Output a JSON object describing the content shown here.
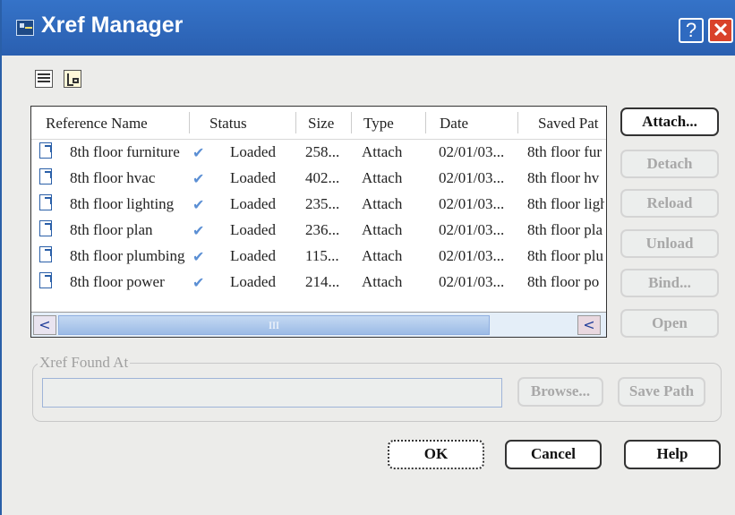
{
  "window": {
    "title": "Xref Manager",
    "help_glyph": "?",
    "close_glyph": "✕"
  },
  "list": {
    "headers": [
      "Reference Name",
      "Status",
      "Size",
      "Type",
      "Date",
      "Saved Pat"
    ],
    "rows": [
      {
        "name": "8th floor furniture",
        "status": "Loaded",
        "size": "258...",
        "type": "Attach",
        "date": "02/01/03...",
        "saved": "8th floor fur"
      },
      {
        "name": "8th floor hvac",
        "status": "Loaded",
        "size": "402...",
        "type": "Attach",
        "date": "02/01/03...",
        "saved": "8th floor hv"
      },
      {
        "name": "8th floor lighting",
        "status": "Loaded",
        "size": "235...",
        "type": "Attach",
        "date": "02/01/03...",
        "saved": "8th floor ligh"
      },
      {
        "name": "8th floor plan",
        "status": "Loaded",
        "size": "236...",
        "type": "Attach",
        "date": "02/01/03...",
        "saved": "8th floor pla"
      },
      {
        "name": "8th floor plumbing",
        "status": "Loaded",
        "size": "115...",
        "type": "Attach",
        "date": "02/01/03...",
        "saved": "8th floor plu"
      },
      {
        "name": "8th floor power",
        "status": "Loaded",
        "size": "214...",
        "type": "Attach",
        "date": "02/01/03...",
        "saved": "8th floor po"
      }
    ],
    "scroll_left": "<",
    "scroll_right": "<",
    "scroll_grip": "III"
  },
  "side_buttons": {
    "attach": "Attach...",
    "detach": "Detach",
    "reload": "Reload",
    "unload": "Unload",
    "bind": "Bind...",
    "open": "Open"
  },
  "found_at": {
    "label": "Xref Found At",
    "value": "",
    "browse": "Browse...",
    "save_path": "Save Path"
  },
  "dialog_buttons": {
    "ok": "OK",
    "cancel": "Cancel",
    "help": "Help"
  },
  "colors": {
    "titlebar": "#2f6ac0",
    "close": "#d9422a",
    "check": "#5b8fd4"
  }
}
